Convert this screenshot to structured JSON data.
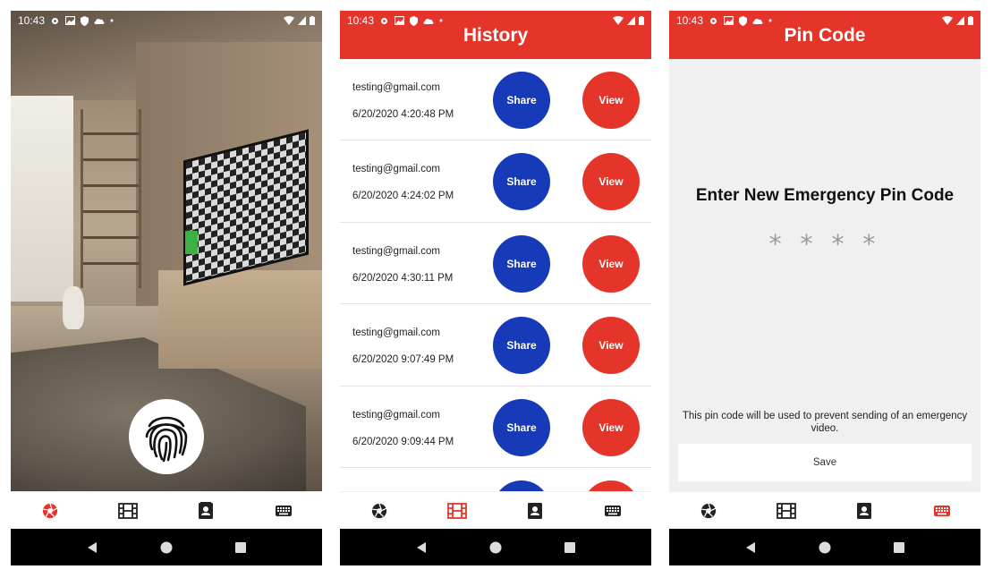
{
  "status_bar": {
    "time": "10:43"
  },
  "screens": {
    "camera": {
      "fingerprint_icon": "fingerprint-icon"
    },
    "history": {
      "title": "History",
      "items": [
        {
          "email": "testing@gmail.com",
          "date": "6/20/2020 4:20:48 PM",
          "share_label": "Share",
          "view_label": "View"
        },
        {
          "email": "testing@gmail.com",
          "date": "6/20/2020 4:24:02 PM",
          "share_label": "Share",
          "view_label": "View"
        },
        {
          "email": "testing@gmail.com",
          "date": "6/20/2020 4:30:11 PM",
          "share_label": "Share",
          "view_label": "View"
        },
        {
          "email": "testing@gmail.com",
          "date": "6/20/2020 9:07:49 PM",
          "share_label": "Share",
          "view_label": "View"
        },
        {
          "email": "testing@gmail.com",
          "date": "6/20/2020 9:09:44 PM",
          "share_label": "Share",
          "view_label": "View"
        }
      ]
    },
    "pin_code": {
      "title": "Pin Code",
      "heading": "Enter New Emergency Pin Code",
      "pin_masked": "* * * *",
      "note": "This pin code will be used to prevent sending of an emergency video.",
      "save_label": "Save"
    }
  },
  "bottom_nav": {
    "items": [
      "camera-shutter-icon",
      "film-icon",
      "contact-card-icon",
      "keyboard-icon"
    ],
    "active_color": "#e53429",
    "inactive_color": "#222222"
  },
  "colors": {
    "app_bar": "#e53429",
    "share_button": "#173bb8",
    "view_button": "#e53429"
  }
}
